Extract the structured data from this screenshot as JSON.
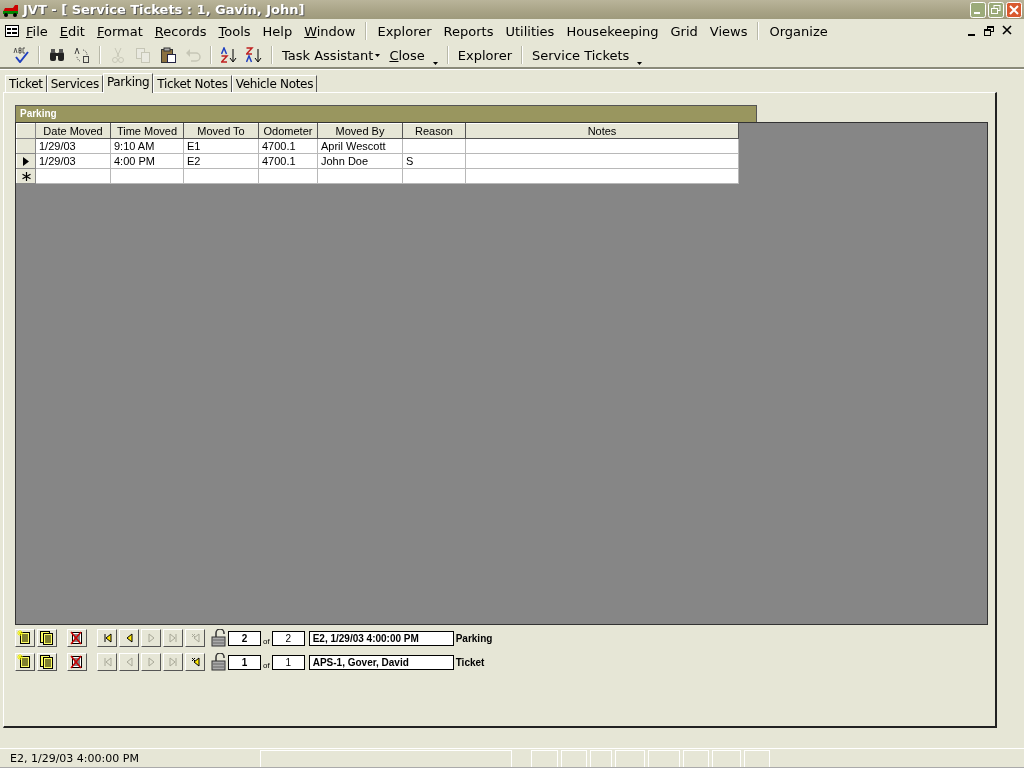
{
  "window": {
    "title": "JVT - [ Service Tickets : 1, Gavin, John]"
  },
  "menu_groups": [
    [
      {
        "label": "File",
        "underlined": true
      },
      {
        "label": "Edit",
        "underlined": true
      },
      {
        "label": "Format",
        "underlined": true
      },
      {
        "label": "Records",
        "underlined": true
      },
      {
        "label": "Tools",
        "underlined": true
      },
      {
        "label": "Help",
        "underlined": false
      },
      {
        "label": "Window",
        "underlined": true
      }
    ],
    [
      {
        "label": "Explorer",
        "underlined": false
      },
      {
        "label": "Reports",
        "underlined": false
      },
      {
        "label": "Utilities",
        "underlined": false
      },
      {
        "label": "Housekeeping",
        "underlined": false
      },
      {
        "label": "Grid",
        "underlined": false
      },
      {
        "label": "Views",
        "underlined": false
      }
    ],
    [
      {
        "label": "Organize",
        "underlined": false
      }
    ]
  ],
  "toolbar": [
    {
      "kind": "spell",
      "disabled": false
    },
    {
      "kind": "sep"
    },
    {
      "kind": "find",
      "disabled": false
    },
    {
      "kind": "replace",
      "disabled": false
    },
    {
      "kind": "sep"
    },
    {
      "kind": "cut",
      "disabled": true
    },
    {
      "kind": "copy",
      "disabled": true
    },
    {
      "kind": "paste",
      "disabled": false
    },
    {
      "kind": "undo",
      "disabled": true
    },
    {
      "kind": "sep"
    },
    {
      "kind": "sortasc",
      "disabled": false
    },
    {
      "kind": "sortdesc",
      "disabled": false
    },
    {
      "kind": "sep"
    },
    {
      "kind": "menubutton",
      "label": "Task Assistant",
      "underlined": false,
      "dropdown": true
    },
    {
      "kind": "text",
      "label": "Close",
      "underlined": true,
      "dropdown": true
    },
    {
      "kind": "sep"
    },
    {
      "kind": "text",
      "label": "Explorer",
      "underlined": false,
      "dropdown": false
    },
    {
      "kind": "sep"
    },
    {
      "kind": "text",
      "label": "Service Tickets",
      "underlined": false,
      "dropdown": true
    }
  ],
  "tabs": [
    {
      "label": "Ticket",
      "selected": false
    },
    {
      "label": "Services",
      "selected": false
    },
    {
      "label": "Parking",
      "selected": true
    },
    {
      "label": "Ticket Notes",
      "selected": false
    },
    {
      "label": "Vehicle Notes",
      "selected": false
    }
  ],
  "grid": {
    "title": "Parking",
    "columns": [
      "Date Moved",
      "Time Moved",
      "Moved To",
      "Odometer",
      "Moved By",
      "Reason",
      "Notes"
    ],
    "rows": [
      {
        "current": false,
        "cells": [
          "1/29/03",
          "9:10 AM",
          "E1",
          "4700.1",
          "April Wescott",
          "",
          ""
        ]
      },
      {
        "current": true,
        "cells": [
          "1/29/03",
          "4:00 PM",
          "E2",
          "4700.1",
          "John Doe",
          "S",
          ""
        ]
      }
    ],
    "new_record_row": true
  },
  "navigators": [
    {
      "record": "2",
      "of": "of",
      "total": "2",
      "description": "E2, 1/29/03 4:00:00 PM",
      "label": "Parking",
      "first_disabled": false,
      "prev_disabled": false,
      "next_disabled": true,
      "last_disabled": true,
      "new_disabled": true
    },
    {
      "record": "1",
      "of": "of",
      "total": "1",
      "description": "APS-1, Gover, David",
      "label": "Ticket",
      "first_disabled": true,
      "prev_disabled": true,
      "next_disabled": true,
      "last_disabled": true,
      "new_disabled": false
    }
  ],
  "status_bar": {
    "text": "E2, 1/29/03 4:00:00 PM"
  }
}
